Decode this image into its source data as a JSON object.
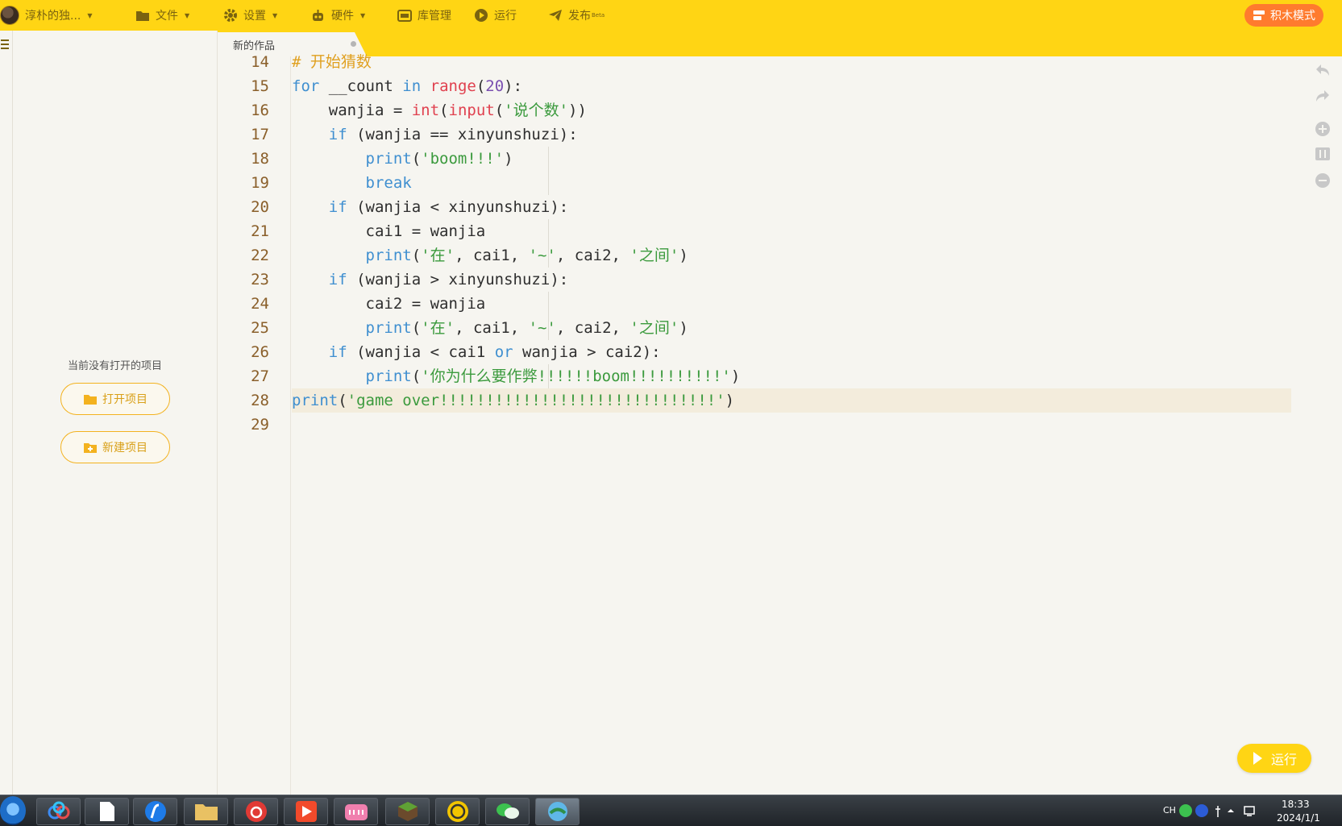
{
  "topbar": {
    "user_name": "淳朴的独...",
    "file_label": "文件",
    "settings_label": "设置",
    "hardware_label": "硬件",
    "library_label": "库管理",
    "run_label": "运行",
    "publish_label": "发布",
    "publish_badge": "Beta",
    "block_mode_label": "积木模式"
  },
  "sidebar": {
    "no_project_text": "当前没有打开的项目",
    "open_project_label": "打开项目",
    "new_project_label": "新建项目"
  },
  "tabs": [
    {
      "label": "新的作品",
      "unsaved": true
    }
  ],
  "editor": {
    "line_numbers": [
      "14",
      "15",
      "16",
      "17",
      "18",
      "19",
      "20",
      "21",
      "22",
      "23",
      "24",
      "25",
      "26",
      "27",
      "28",
      "29"
    ],
    "active_line": 28,
    "lines": [
      "# 开始猜数",
      "for __count in range(20):",
      "    wanjia = int(input('说个数'))",
      "    if (wanjia == xinyunshuzi):",
      "        print('boom!!!')",
      "        break",
      "    if (wanjia < xinyunshuzi):",
      "        cai1 = wanjia",
      "        print('在', cai1, '~', cai2, '之间')",
      "    if (wanjia > xinyunshuzi):",
      "        cai2 = wanjia",
      "        print('在', cai1, '~', cai2, '之间')",
      "    if (wanjia < cai1 or wanjia > cai2):",
      "        print('你为什么要作弊!!!!!!boom!!!!!!!!!!')",
      "print('game over!!!!!!!!!!!!!!!!!!!!!!!!!!!!!!')",
      ""
    ]
  },
  "run_button": {
    "label": "运行"
  },
  "taskbar": {
    "apps": [
      "baidu-netdisk",
      "file",
      "flash",
      "file-explorer",
      "netease-music",
      "video-player",
      "bilibili",
      "minecraft",
      "lightning",
      "wechat",
      "coding-app"
    ],
    "ime": "CH",
    "time": "18:33",
    "date": "2024/1/1"
  },
  "colors": {
    "accent": "#ffd514",
    "block_mode": "#ff7b2e",
    "keyword": "#3f8fd0",
    "builtin": "#e0414f",
    "string": "#3b9a3d",
    "comment": "#e0a020"
  }
}
